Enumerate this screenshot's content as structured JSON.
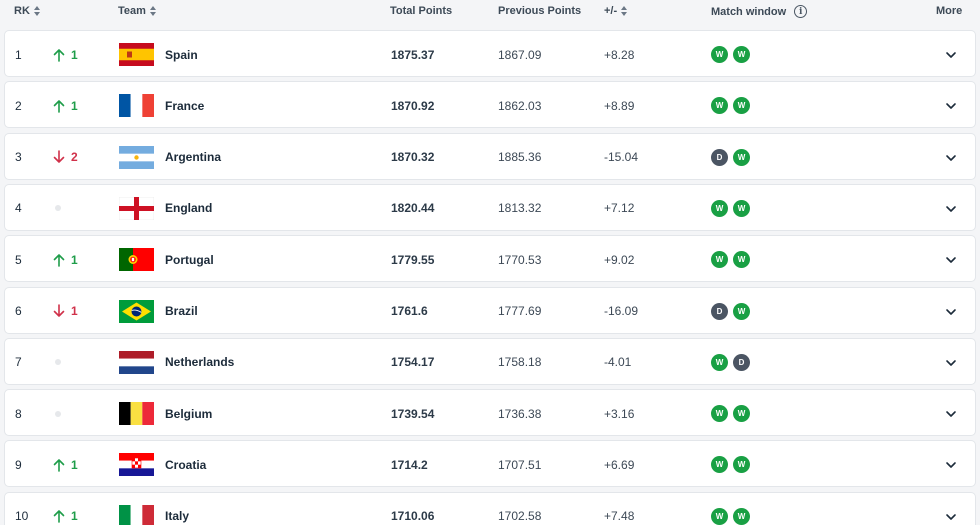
{
  "header": {
    "rank": "RK",
    "team": "Team",
    "total": "Total Points",
    "previous": "Previous Points",
    "diff": "+/-",
    "match_window": "Match window",
    "more": "More"
  },
  "colors": {
    "win": "#19a044",
    "draw": "#4b5563",
    "up": "#1f9d4a",
    "down": "#d0314a"
  },
  "rows": [
    {
      "rank": "1",
      "dir": "up",
      "move": "1",
      "team": "Spain",
      "flag": "spain",
      "total": "1875.37",
      "previous": "1867.09",
      "diff": "+8.28",
      "results": [
        "W",
        "W"
      ]
    },
    {
      "rank": "2",
      "dir": "up",
      "move": "1",
      "team": "France",
      "flag": "france",
      "total": "1870.92",
      "previous": "1862.03",
      "diff": "+8.89",
      "results": [
        "W",
        "W"
      ]
    },
    {
      "rank": "3",
      "dir": "down",
      "move": "2",
      "team": "Argentina",
      "flag": "argentina",
      "total": "1870.32",
      "previous": "1885.36",
      "diff": "-15.04",
      "results": [
        "D",
        "W"
      ]
    },
    {
      "rank": "4",
      "dir": "same",
      "move": "",
      "team": "England",
      "flag": "england",
      "total": "1820.44",
      "previous": "1813.32",
      "diff": "+7.12",
      "results": [
        "W",
        "W"
      ]
    },
    {
      "rank": "5",
      "dir": "up",
      "move": "1",
      "team": "Portugal",
      "flag": "portugal",
      "total": "1779.55",
      "previous": "1770.53",
      "diff": "+9.02",
      "results": [
        "W",
        "W"
      ]
    },
    {
      "rank": "6",
      "dir": "down",
      "move": "1",
      "team": "Brazil",
      "flag": "brazil",
      "total": "1761.6",
      "previous": "1777.69",
      "diff": "-16.09",
      "results": [
        "D",
        "W"
      ]
    },
    {
      "rank": "7",
      "dir": "same",
      "move": "",
      "team": "Netherlands",
      "flag": "netherlands",
      "total": "1754.17",
      "previous": "1758.18",
      "diff": "-4.01",
      "results": [
        "W",
        "D"
      ]
    },
    {
      "rank": "8",
      "dir": "same",
      "move": "",
      "team": "Belgium",
      "flag": "belgium",
      "total": "1739.54",
      "previous": "1736.38",
      "diff": "+3.16",
      "results": [
        "W",
        "W"
      ]
    },
    {
      "rank": "9",
      "dir": "up",
      "move": "1",
      "team": "Croatia",
      "flag": "croatia",
      "total": "1714.2",
      "previous": "1707.51",
      "diff": "+6.69",
      "results": [
        "W",
        "W"
      ]
    },
    {
      "rank": "10",
      "dir": "up",
      "move": "1",
      "team": "Italy",
      "flag": "italy",
      "total": "1710.06",
      "previous": "1702.58",
      "diff": "+7.48",
      "results": [
        "W",
        "W"
      ]
    }
  ]
}
